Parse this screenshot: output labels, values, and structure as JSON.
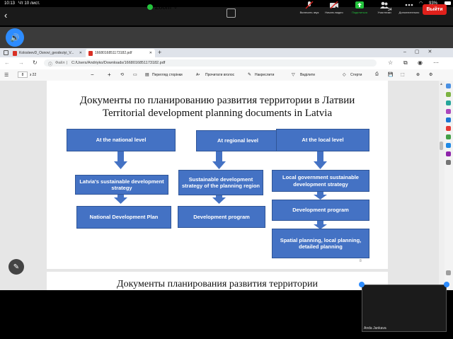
{
  "status": {
    "time": "10:13",
    "date": "Чт 10 лист.",
    "battery": "93%"
  },
  "zoom": {
    "title": "Zoom",
    "buttons": [
      {
        "label": "Включить звук"
      },
      {
        "label": "Начать видео"
      },
      {
        "label": "Поделиться"
      },
      {
        "label": "Участники"
      },
      {
        "label": "Дополнительно"
      }
    ],
    "participants_count": "34",
    "leave": "Выйти"
  },
  "browser": {
    "tabs": [
      "KolosleevD_Osnovi_geodeziyi_V...",
      "1668016851173182.pdf"
    ],
    "address_prefix": "Файл",
    "address": "C:/Users/Andriyko/Downloads/1668016851173182.pdf",
    "page_current": "8",
    "page_total": "з 22",
    "toolbar": {
      "view": "Перегляд сторінки",
      "read": "Прочитати вголос",
      "draw": "Накреслити",
      "highlight": "Виділити",
      "erase": "Стерти"
    }
  },
  "slide": {
    "title_ru": "Документы по планированию развития территории в Латвии",
    "title_en": "Territorial development planning documents in Latvia",
    "national_header": "At the national level",
    "national_strategy": "Latvia's sustainable development strategy",
    "national_plan": "National Development Plan",
    "regional_header": "At regional level",
    "regional_strategy": "Sustainable development strategy of the planning region",
    "regional_program": "Development program",
    "local_header": "At the local level",
    "local_strategy": "Local government sustainable development strategy",
    "local_program": "Development program",
    "local_planning": "Spatial planning, local planning, detailed planning",
    "page_number": "8"
  },
  "next_slide_title": "Документы планирования развития территории",
  "video": {
    "name": "Anda Jankava"
  }
}
